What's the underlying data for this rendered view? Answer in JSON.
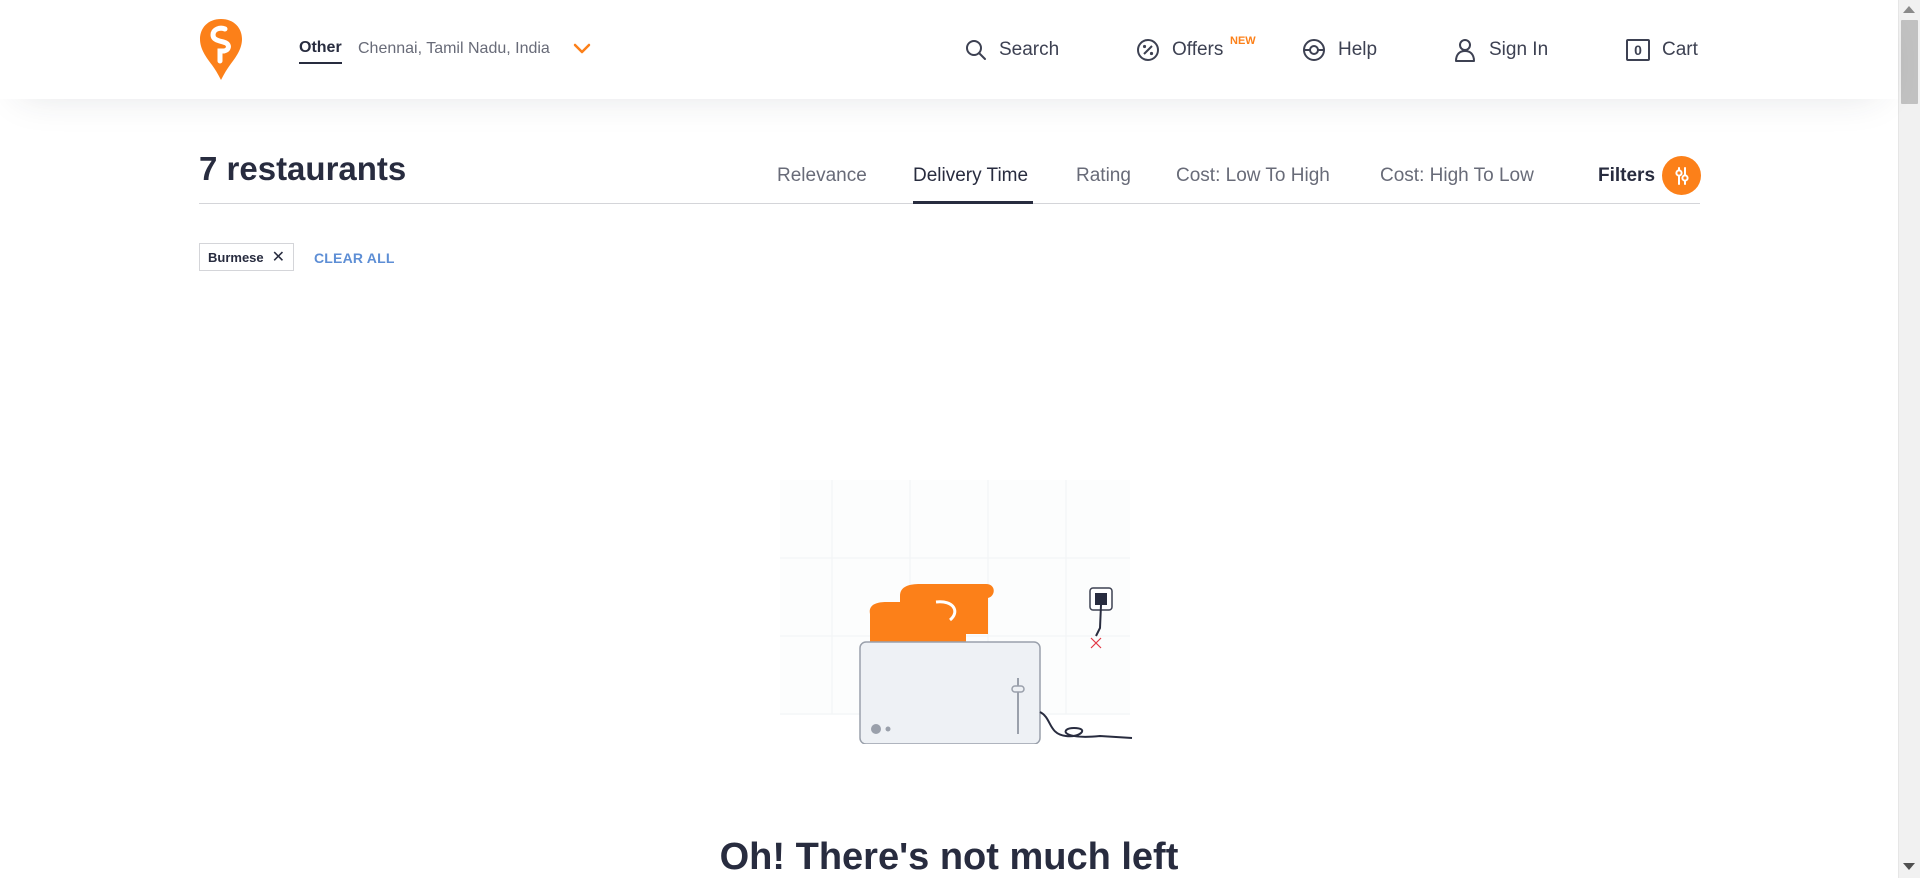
{
  "header": {
    "location_label": "Other",
    "location_address": "Chennai, Tamil Nadu, India",
    "nav": {
      "search": "Search",
      "offers": "Offers",
      "offers_badge": "NEW",
      "help": "Help",
      "sign_in": "Sign In",
      "cart": "Cart",
      "cart_count": "0"
    }
  },
  "listing": {
    "count_title": "7 restaurants",
    "sort_options": [
      "Relevance",
      "Delivery Time",
      "Rating",
      "Cost: Low To High",
      "Cost: High To Low"
    ],
    "active_sort": "Delivery Time",
    "filters_label": "Filters",
    "applied_filters": [
      "Burmese"
    ],
    "clear_all": "CLEAR ALL"
  },
  "empty_state": {
    "title": "Oh! There's not much left"
  },
  "colors": {
    "brand": "#fc8019",
    "text_dark": "#282c3f",
    "text_muted": "#686b78",
    "link_blue": "#5d8ed5"
  },
  "icons": {
    "logo": "swiggy-logo-icon",
    "location_dropdown": "chevron-down-icon",
    "search": "search-icon",
    "offers": "offer-percent-icon",
    "help": "lifebuoy-icon",
    "sign_in": "user-icon",
    "cart": "cart-bag-icon",
    "filters": "filter-sliders-icon",
    "chip_remove": "close-icon"
  }
}
